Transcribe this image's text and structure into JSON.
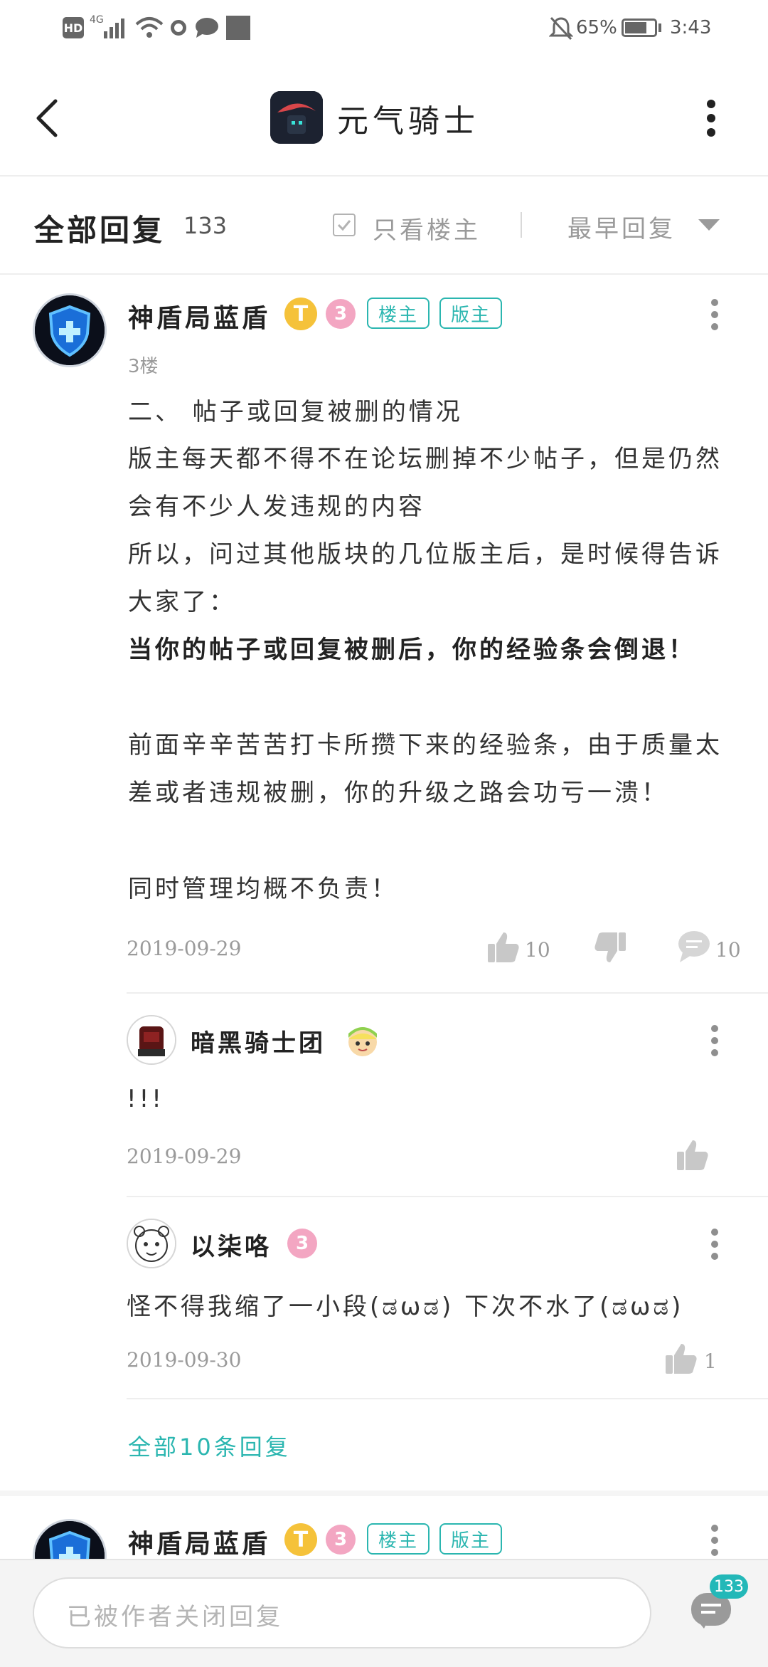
{
  "status_bar": {
    "hd": "HD",
    "signal": "4G",
    "battery_pct": "65%",
    "time": "3:43"
  },
  "header": {
    "title": "元气骑士",
    "back_icon": "chevron-left-icon",
    "menu_icon": "vertical-dots-icon"
  },
  "filter": {
    "title": "全部回复",
    "count": "133",
    "only_owner": "只看楼主",
    "sort": "最早回复"
  },
  "post": {
    "username": "神盾局蓝盾",
    "badge_t": "T",
    "badge_level": "3",
    "tags": [
      "楼主",
      "版主"
    ],
    "floor": "3楼",
    "paragraphs": [
      {
        "text": "二、 帖子或回复被删的情况",
        "bold": false
      },
      {
        "text": "版主每天都不得不在论坛删掉不少帖子，但是仍然会有不少人发违规的内容",
        "bold": false
      },
      {
        "text": "所以，问过其他版块的几位版主后，是时候得告诉大家了：",
        "bold": false
      },
      {
        "text": "当你的帖子或回复被删后，你的经验条会倒退！",
        "bold": true
      },
      {
        "text": "前面辛辛苦苦打卡所攒下来的经验条，由于质量太差或者违规被删，你的升级之路会功亏一溃！",
        "bold": false
      },
      {
        "text": "同时管理均概不负责！",
        "bold": false
      }
    ],
    "date": "2019-09-29",
    "likes": "10",
    "comments": "10"
  },
  "replies": [
    {
      "username": "暗黑骑士团",
      "text": "!!!",
      "date": "2019-09-29",
      "likes": ""
    },
    {
      "username": "以柒咯",
      "badge_level": "3",
      "text": "怪不得我缩了一小段(ಡωಡ) 下次不水了(ಡωಡ)",
      "date": "2019-09-30",
      "likes": "1"
    }
  ],
  "more_replies": "全部10条回复",
  "next_post": {
    "username": "神盾局蓝盾",
    "badge_t": "T",
    "badge_level": "3",
    "tags": [
      "楼主",
      "版主"
    ]
  },
  "bottom": {
    "placeholder": "已被作者关闭回复",
    "comment_badge": "133"
  },
  "colors": {
    "accent": "#2bb6b0",
    "badge_gold": "#f5c23a",
    "badge_pink": "#f3a6c2"
  }
}
